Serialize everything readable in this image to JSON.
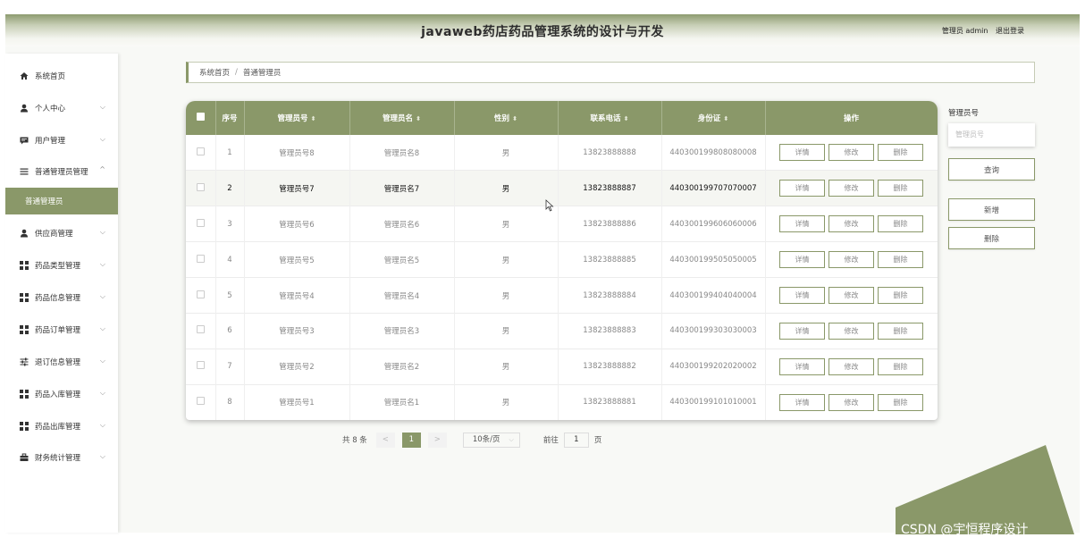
{
  "header": {
    "title": "javaweb药店药品管理系统的设计与开发",
    "user_label": "管理员 admin",
    "logout_label": "退出登录"
  },
  "sidebar": {
    "items": [
      {
        "label": "系统首页",
        "icon": "home-icon"
      },
      {
        "label": "个人中心",
        "icon": "user-icon"
      },
      {
        "label": "用户管理",
        "icon": "message-icon"
      },
      {
        "label": "普通管理员管理",
        "icon": "list-icon",
        "expanded": true
      },
      {
        "label": "供应商管理",
        "icon": "user-icon"
      },
      {
        "label": "药品类型管理",
        "icon": "grid-icon"
      },
      {
        "label": "药品信息管理",
        "icon": "grid-icon"
      },
      {
        "label": "药品订单管理",
        "icon": "grid-icon"
      },
      {
        "label": "退订信息管理",
        "icon": "sliders-icon"
      },
      {
        "label": "药品入库管理",
        "icon": "grid-icon"
      },
      {
        "label": "药品出库管理",
        "icon": "grid-icon"
      },
      {
        "label": "财务统计管理",
        "icon": "briefcase-icon"
      }
    ],
    "active_sub": "普通管理员",
    "accent": "#8a9869"
  },
  "breadcrumb": {
    "home": "系统首页",
    "separator": "/",
    "current": "普通管理员"
  },
  "table": {
    "columns": [
      "序号",
      "管理员号",
      "管理员名",
      "性别",
      "联系电话",
      "身份证",
      "操作"
    ],
    "rows": [
      {
        "no": "1",
        "id": "管理员号8",
        "name": "管理员名8",
        "gender": "男",
        "phone": "13823888888",
        "idcard": "440300199808080008"
      },
      {
        "no": "2",
        "id": "管理员号7",
        "name": "管理员名7",
        "gender": "男",
        "phone": "13823888887",
        "idcard": "440300199707070007"
      },
      {
        "no": "3",
        "id": "管理员号6",
        "name": "管理员名6",
        "gender": "男",
        "phone": "13823888886",
        "idcard": "440300199606060006"
      },
      {
        "no": "4",
        "id": "管理员号5",
        "name": "管理员名5",
        "gender": "男",
        "phone": "13823888885",
        "idcard": "440300199505050005"
      },
      {
        "no": "5",
        "id": "管理员号4",
        "name": "管理员名4",
        "gender": "男",
        "phone": "13823888884",
        "idcard": "440300199404040004"
      },
      {
        "no": "6",
        "id": "管理员号3",
        "name": "管理员名3",
        "gender": "男",
        "phone": "13823888883",
        "idcard": "440300199303030003"
      },
      {
        "no": "7",
        "id": "管理员号2",
        "name": "管理员名2",
        "gender": "男",
        "phone": "13823888882",
        "idcard": "440300199202020002"
      },
      {
        "no": "8",
        "id": "管理员号1",
        "name": "管理员名1",
        "gender": "男",
        "phone": "13823888881",
        "idcard": "440300199101010001"
      }
    ],
    "actions": [
      "详情",
      "修改",
      "删除"
    ]
  },
  "pagination": {
    "total_label": "共 8 条",
    "prev": "<",
    "current_page": "1",
    "next": ">",
    "page_size": "10条/页",
    "goto_label": "前往",
    "goto_value": "1",
    "page_unit": "页"
  },
  "search": {
    "label": "管理员号",
    "placeholder": "管理员号",
    "query_button": "查询",
    "add_button": "新增",
    "delete_button": "删除"
  },
  "watermark": "CSDN @宇恒程序设计"
}
